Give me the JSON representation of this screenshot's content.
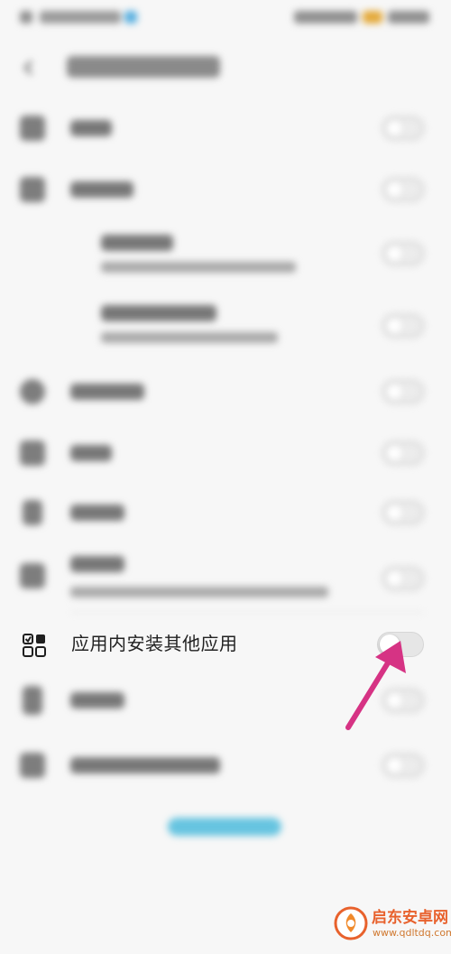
{
  "focus_item": {
    "label": "应用内安装其他应用",
    "icon": "apps-grid-icon",
    "toggle": "off"
  },
  "arrow": {
    "color": "#d63384"
  },
  "watermark": {
    "name": "启东安卓网",
    "url": "www.qdltdq.com"
  }
}
